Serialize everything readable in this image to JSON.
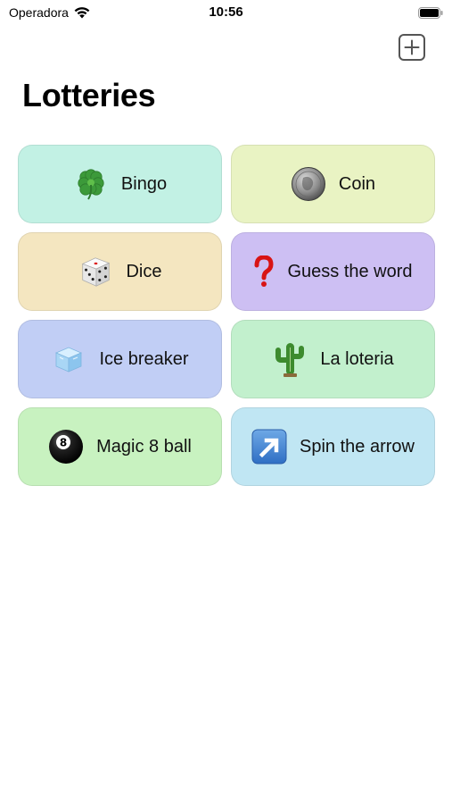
{
  "status_bar": {
    "carrier": "Operadora",
    "time": "10:56"
  },
  "header": {
    "title": "Lotteries",
    "add_icon": "plus-square-icon"
  },
  "lotteries": [
    {
      "label": "Bingo",
      "icon": "four-leaf-clover-icon",
      "bg": "#c2f1e4"
    },
    {
      "label": "Coin",
      "icon": "coin-icon",
      "bg": "#e9f3c3"
    },
    {
      "label": "Dice",
      "icon": "dice-icon",
      "bg": "#f4e6c0"
    },
    {
      "label": "Guess the word",
      "icon": "question-mark-icon",
      "bg": "#cdbff3"
    },
    {
      "label": "Ice breaker",
      "icon": "ice-cube-icon",
      "bg": "#c1cef5"
    },
    {
      "label": "La loteria",
      "icon": "cactus-icon",
      "bg": "#c2f0cd"
    },
    {
      "label": "Magic 8 ball",
      "icon": "eight-ball-icon",
      "bg": "#c8f2c0"
    },
    {
      "label": "Spin the arrow",
      "icon": "arrow-up-right-icon",
      "bg": "#c0e6f3"
    }
  ]
}
